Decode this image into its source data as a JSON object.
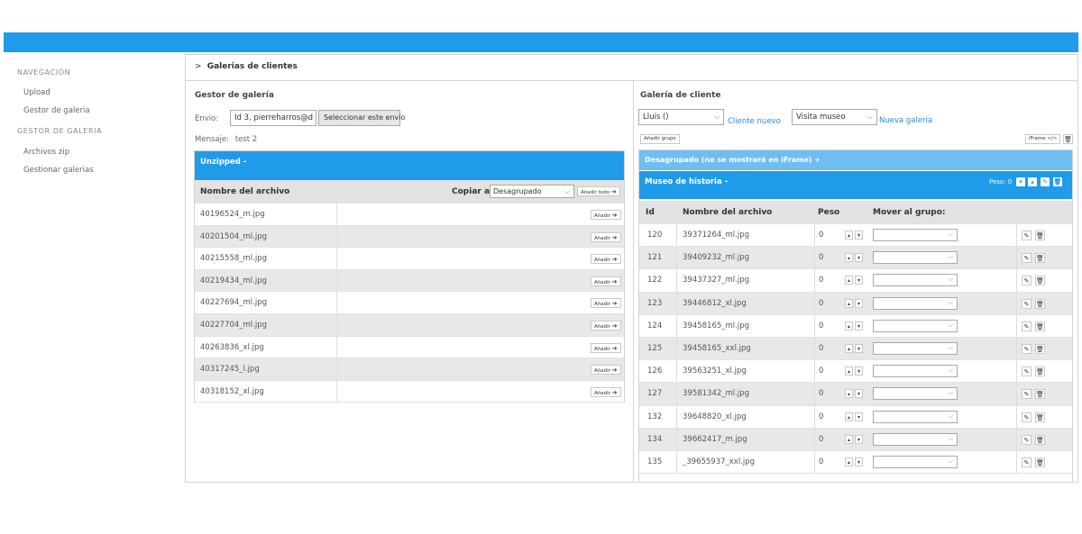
{
  "sidebar": {
    "section_nav": "NAVEGACIÓN",
    "nav_items": [
      {
        "label": "Upload"
      },
      {
        "label": "Gestor de galeria"
      }
    ],
    "section_gallery": "GESTOR DE GALERIA",
    "gallery_items": [
      {
        "label": "Archivos zip"
      },
      {
        "label": "Gestionar galerias"
      }
    ]
  },
  "breadcrumb": {
    "marker": ">",
    "title": "Galerias de clientes"
  },
  "left": {
    "title": "Gestor de galería",
    "envio_label": "Envio:",
    "envio_value": "Id 3, pierreharros@d",
    "select_button": "Seleccionar este envio",
    "mensaje_label": "Mensaje:",
    "mensaje_value": "test 2",
    "unzipped_label": "Unzipped -",
    "col_filename": "Nombre del archivo",
    "copiar_label": "Copiar a:",
    "copiar_value": "Desagrupado",
    "add_all_button": "Añadir todo",
    "add_button": "Añadir",
    "files": [
      "40196524_m.jpg",
      "40201504_ml.jpg",
      "40215558_ml.jpg",
      "40219434_ml.jpg",
      "40227694_ml.jpg",
      "40227704_ml.jpg",
      "40263836_xl.jpg",
      "40317245_l.jpg",
      "40318152_xl.jpg"
    ]
  },
  "right": {
    "title": "Galería de cliente",
    "client_value": "Lluis ()",
    "new_client_link": "Cliente nuevo",
    "gallery_value": "Visita museo",
    "new_gallery_link": "Nueva galeria",
    "add_group_button": "Añadir grupo",
    "iframe_button": "iFrame </>",
    "ungrouped_label": "Desagrupado (no se mostrará en iFrame) +",
    "group_label": "Museo de historia -",
    "peso_label": "Peso: 0",
    "col_id": "Id",
    "col_filename": "Nombre del archivo",
    "col_peso": "Peso",
    "col_move": "Mover al grupo:",
    "rows": [
      {
        "id": "120",
        "file": "39371264_ml.jpg",
        "peso": "0"
      },
      {
        "id": "121",
        "file": "39409232_ml.jpg",
        "peso": "0"
      },
      {
        "id": "122",
        "file": "39437327_ml.jpg",
        "peso": "0"
      },
      {
        "id": "123",
        "file": "39446812_xl.jpg",
        "peso": "0"
      },
      {
        "id": "124",
        "file": "39458165_ml.jpg",
        "peso": "0"
      },
      {
        "id": "125",
        "file": "39458165_xxl.jpg",
        "peso": "0"
      },
      {
        "id": "126",
        "file": "39563251_xl.jpg",
        "peso": "0"
      },
      {
        "id": "127",
        "file": "39581342_ml.jpg",
        "peso": "0"
      },
      {
        "id": "132",
        "file": "39648820_xl.jpg",
        "peso": "0"
      },
      {
        "id": "134",
        "file": "39662417_m.jpg",
        "peso": "0"
      },
      {
        "id": "135",
        "file": "_39655937_xxl.jpg",
        "peso": "0"
      }
    ]
  },
  "colors": {
    "accent": "#1e9be9",
    "accent_light": "#6fbef2",
    "link": "#2a89d8"
  }
}
